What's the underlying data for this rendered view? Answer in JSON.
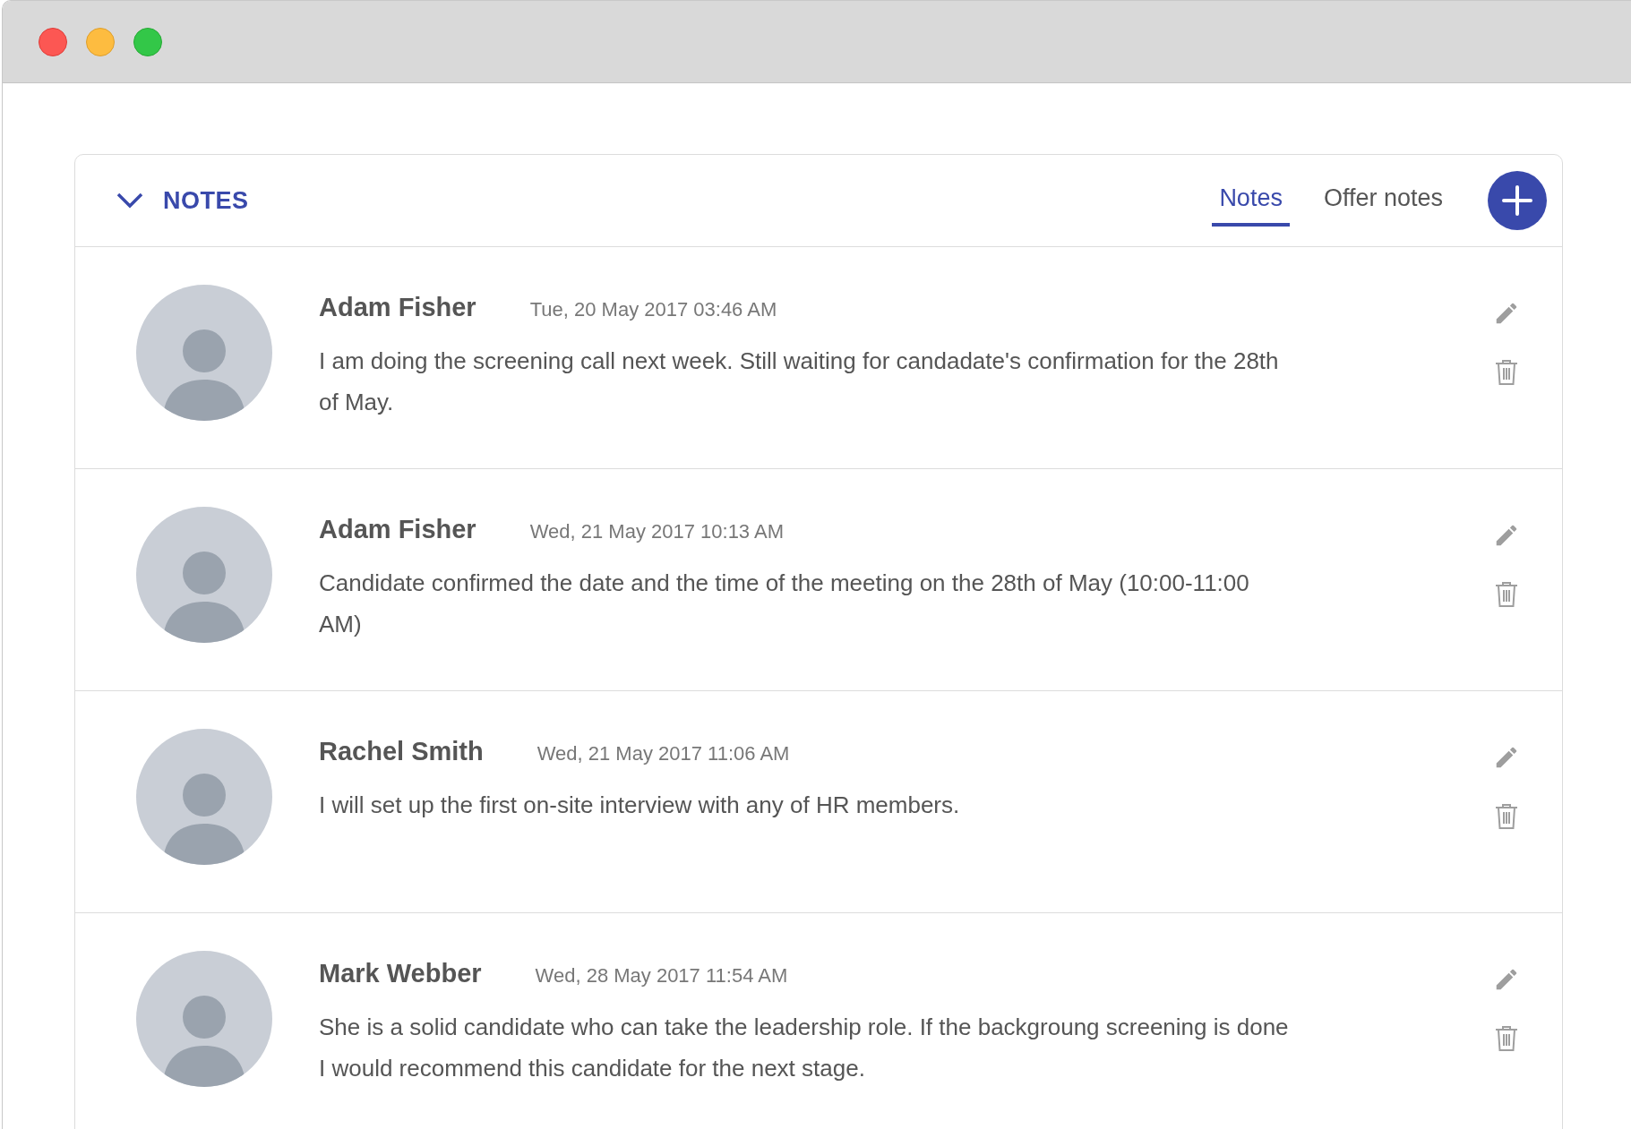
{
  "notes_panel": {
    "title": "NOTES",
    "expanded": true,
    "tabs": [
      {
        "label": "Notes",
        "selected": true
      },
      {
        "label": "Offer notes",
        "selected": false
      }
    ],
    "notes": [
      {
        "author": "Adam Fisher",
        "date": "Tue, 20 May 2017 03:46 AM",
        "text": "I am doing the screening call next week. Still waiting for candadate's confirmation for the 28th of May."
      },
      {
        "author": "Adam Fisher",
        "date": "Wed, 21 May 2017 10:13 AM",
        "text": "Candidate confirmed the date and the time of the meeting on the 28th of May (10:00-11:00 AM)"
      },
      {
        "author": "Rachel Smith",
        "date": "Wed, 21 May 2017 11:06 AM",
        "text": "I will set up the first on-site interview with any of HR members."
      },
      {
        "author": "Mark Webber",
        "date": "Wed, 28 May 2017 11:54 AM",
        "text": "She is a solid candidate who can take the leadership role. If the backgroung screening is done I would recommend this candidate for the next stage."
      }
    ]
  }
}
